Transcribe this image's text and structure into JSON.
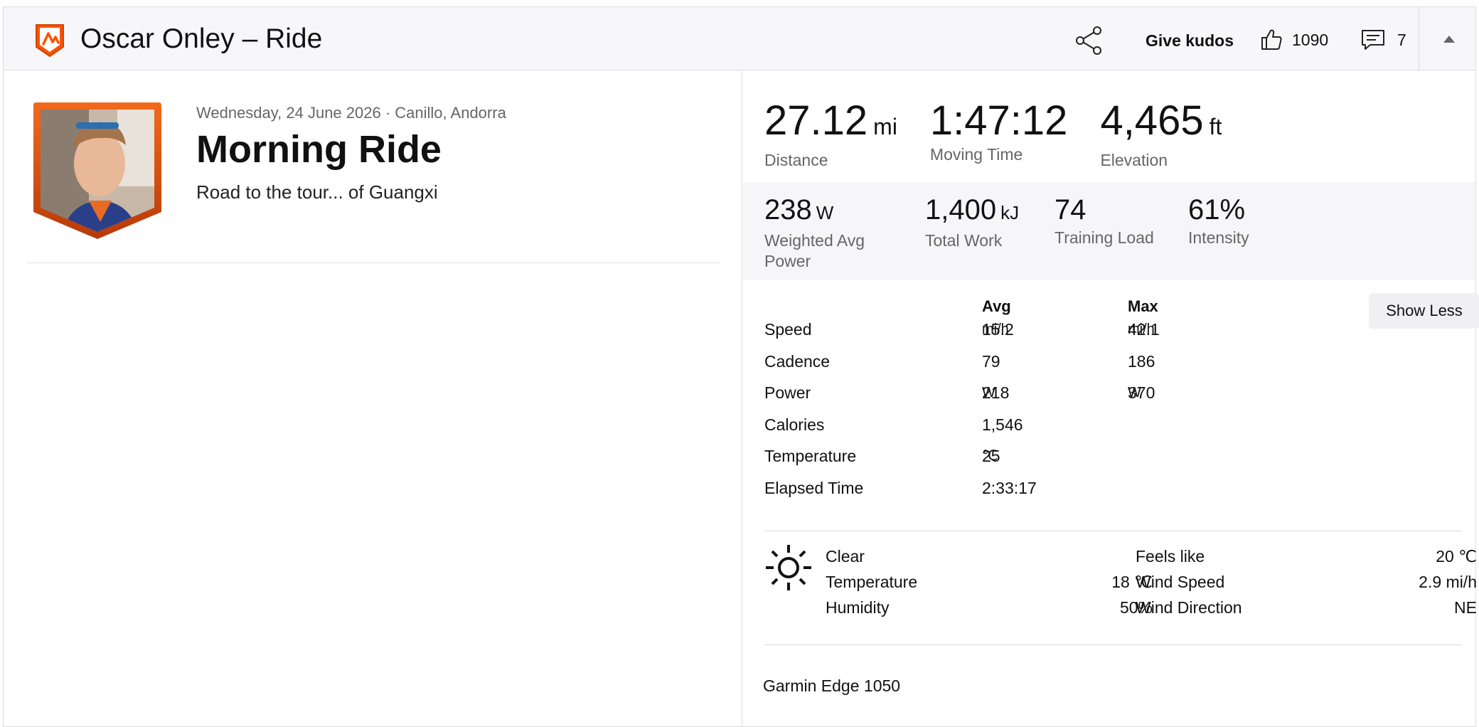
{
  "header": {
    "title": "Oscar Onley – Ride",
    "give_kudos_label": "Give kudos",
    "kudos_count": "1090",
    "comments_count": "7"
  },
  "activity": {
    "meta": "Wednesday, 24 June 2026 · Canillo, Andorra",
    "title": "Morning Ride",
    "description": "Road to the tour... of Guangxi"
  },
  "primary_stats": [
    {
      "value": "27.12",
      "unit": "mi",
      "label": "Distance"
    },
    {
      "value": "1:47:12",
      "unit": "",
      "label": "Moving Time"
    },
    {
      "value": "4,465",
      "unit": "ft",
      "label": "Elevation"
    }
  ],
  "secondary_stats": [
    {
      "value": "238",
      "unit": "W",
      "label": "Weighted Avg Power"
    },
    {
      "value": "1,400",
      "unit": "kJ",
      "label": "Total Work"
    },
    {
      "value": "74",
      "unit": "",
      "label": "Training Load"
    },
    {
      "value": "61%",
      "unit": "",
      "label": "Intensity"
    }
  ],
  "more_stats": {
    "avg_header": "Avg",
    "max_header": "Max",
    "show_less_label": "Show Less",
    "rows": [
      {
        "label": "Speed",
        "avg": "15.2",
        "avg_unit": "mi/h",
        "max": "42.1",
        "max_unit": "mi/h"
      },
      {
        "label": "Cadence",
        "avg": "79",
        "avg_unit": "",
        "max": "186",
        "max_unit": ""
      },
      {
        "label": "Power",
        "avg": "218",
        "avg_unit": "W",
        "max": "370",
        "max_unit": "W"
      },
      {
        "label": "Calories",
        "avg": "1,546",
        "avg_unit": "",
        "max": "",
        "max_unit": ""
      },
      {
        "label": "Temperature",
        "avg": "25",
        "avg_unit": "℃",
        "max": "",
        "max_unit": ""
      },
      {
        "label": "Elapsed Time",
        "avg": "2:33:17",
        "avg_unit": "",
        "max": "",
        "max_unit": ""
      }
    ]
  },
  "weather": {
    "condition": "Clear",
    "temperature_label": "Temperature",
    "temperature_value": "18 ℃",
    "humidity_label": "Humidity",
    "humidity_value": "50%",
    "feels_like_label": "Feels like",
    "feels_like_value": "20 ℃",
    "wind_speed_label": "Wind Speed",
    "wind_speed_value": "2.9 mi/h",
    "wind_direction_label": "Wind Direction",
    "wind_direction_value": "NE",
    "icon": "sun-icon"
  },
  "device": "Garmin Edge 1050",
  "colors": {
    "brand_orange": "#fc5200",
    "header_bg": "#f7f7fa",
    "band_bg": "#f6f6f8"
  }
}
